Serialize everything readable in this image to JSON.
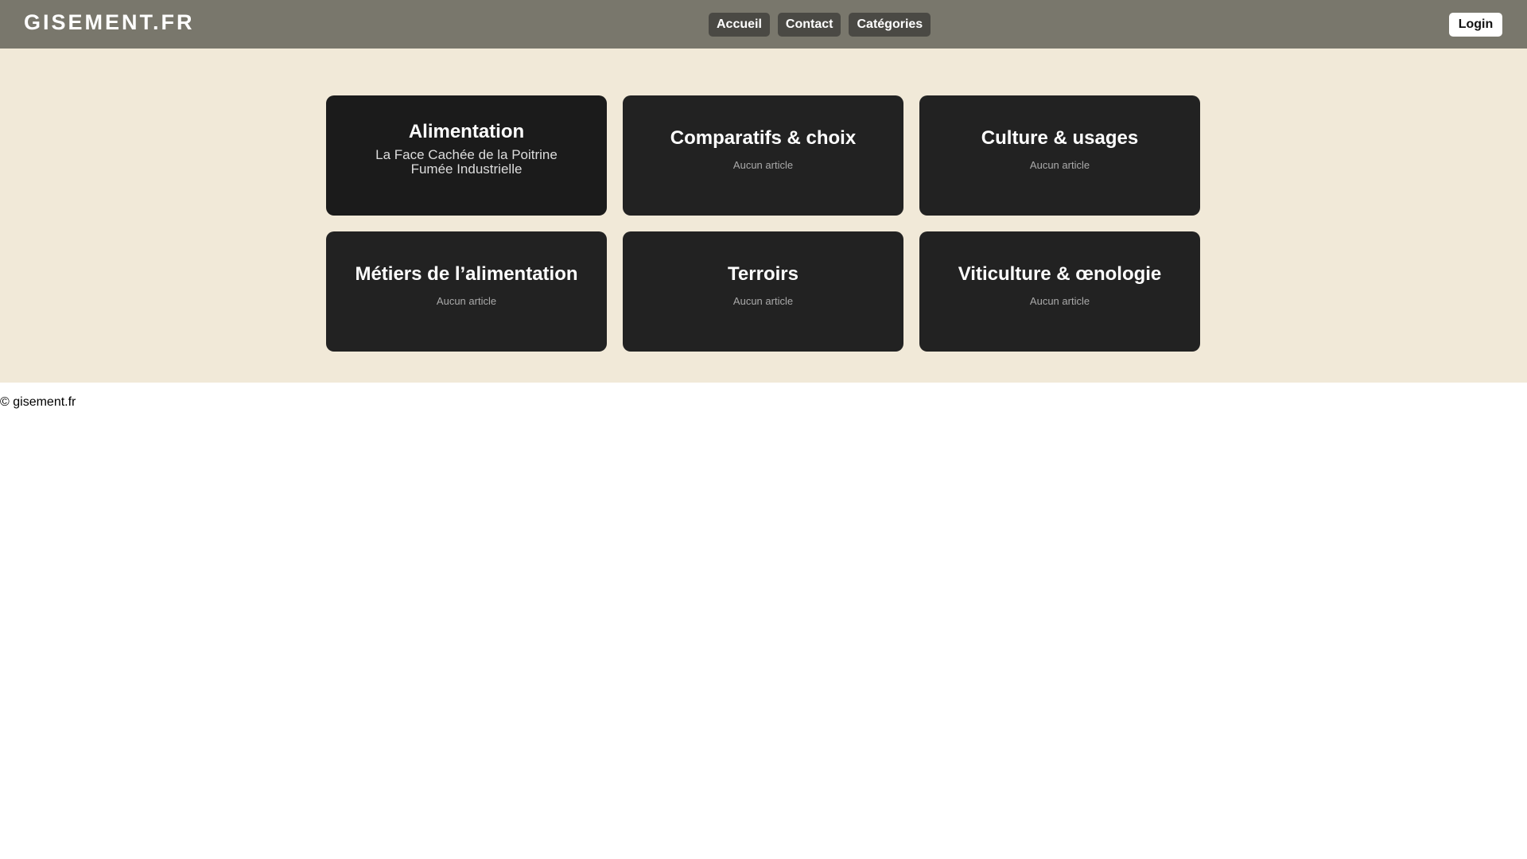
{
  "header": {
    "logo": "GISEMENT.FR",
    "nav": [
      "Accueil",
      "Contact",
      "Catégories"
    ],
    "login": "Login"
  },
  "categories": [
    {
      "title": "Alimentation",
      "article": "La Face Cachée de la Poitrine Fumée Industrielle"
    },
    {
      "title": "Comparatifs & choix",
      "empty": "Aucun article"
    },
    {
      "title": "Culture & usages",
      "empty": "Aucun article"
    },
    {
      "title": "Métiers de l’alimentation",
      "empty": "Aucun article"
    },
    {
      "title": "Terroirs",
      "empty": "Aucun article"
    },
    {
      "title": "Viticulture & œnologie",
      "empty": "Aucun article"
    }
  ],
  "footer": "© gisement.fr"
}
